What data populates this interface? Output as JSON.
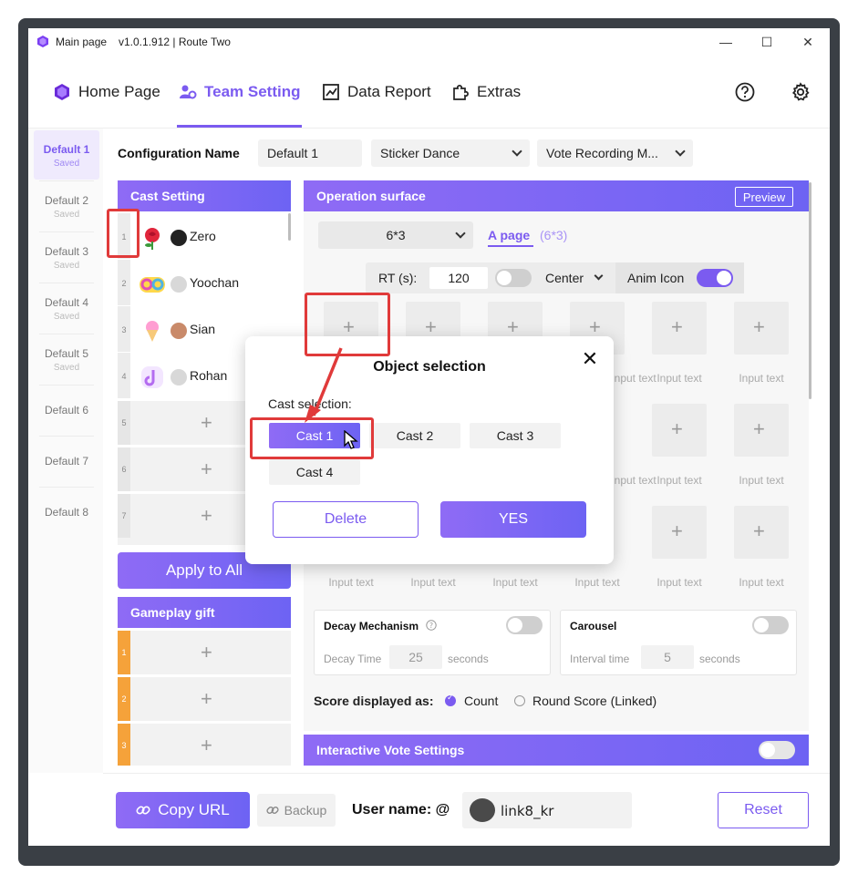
{
  "window": {
    "title": "Main page",
    "version": "v1.0.1.912 | Route Two",
    "minimize": "—",
    "maximize": "☐",
    "close": "✕"
  },
  "nav": {
    "items": [
      {
        "label": "Home Page",
        "icon": "cube-icon"
      },
      {
        "label": "Team Setting",
        "icon": "team-gear-icon"
      },
      {
        "label": "Data Report",
        "icon": "chart-icon"
      },
      {
        "label": "Extras",
        "icon": "puzzle-icon"
      }
    ],
    "help_icon": "question-circle-icon",
    "settings_icon": "gear-icon"
  },
  "configs": [
    {
      "name": "Default 1",
      "status": "Saved"
    },
    {
      "name": "Default 2",
      "status": "Saved"
    },
    {
      "name": "Default 3",
      "status": "Saved"
    },
    {
      "name": "Default 4",
      "status": "Saved"
    },
    {
      "name": "Default 5",
      "status": "Saved"
    },
    {
      "name": "Default 6",
      "status": ""
    },
    {
      "name": "Default 7",
      "status": ""
    },
    {
      "name": "Default 8",
      "status": ""
    }
  ],
  "config_row": {
    "label": "Configuration Name",
    "name_value": "Default 1",
    "sticker_select": "Sticker Dance",
    "mode_select": "Vote Recording M..."
  },
  "cast_setting": {
    "header": "Cast Setting",
    "rows": [
      {
        "num": "1",
        "name": "Zero"
      },
      {
        "num": "2",
        "name": "Yoochan"
      },
      {
        "num": "3",
        "name": "Sian"
      },
      {
        "num": "4",
        "name": "Rohan"
      }
    ],
    "empty_rows": [
      "5",
      "6",
      "7"
    ],
    "plus": "+",
    "apply_label": "Apply to All"
  },
  "gameplay_gift": {
    "header": "Gameplay gift",
    "rows": [
      "1",
      "2",
      "3"
    ]
  },
  "operation": {
    "header": "Operation surface",
    "preview": "Preview",
    "grid_select": "6*3",
    "page_label": "A page",
    "page_sub": "(6*3)",
    "rt_label": "RT (s):",
    "rt_value": "120",
    "align_select": "Center",
    "anim_label": "Anim Icon",
    "input_placeholder": "Input text",
    "decay": {
      "title": "Decay Mechanism",
      "key": "Decay Time",
      "value": "25",
      "unit": "seconds"
    },
    "carousel": {
      "title": "Carousel",
      "key": "Interval time",
      "value": "5",
      "unit": "seconds"
    },
    "score_label": "Score displayed as:",
    "score_opt1": "Count",
    "score_opt2": "Round Score (Linked)",
    "vote_header": "Interactive Vote Settings"
  },
  "bottom": {
    "copy_url": "Copy URL",
    "backup": "Backup",
    "user_label": "User name: @",
    "user_value": "link8_kr",
    "reset": "Reset"
  },
  "modal": {
    "title": "Object selection",
    "sub": "Cast selection:",
    "options": [
      "Cast 1",
      "Cast 2",
      "Cast 3",
      "Cast 4"
    ],
    "delete": "Delete",
    "yes": "YES",
    "close": "✕"
  },
  "colors": {
    "accent": "#7b5bf0",
    "gift": "#f5a23a",
    "annotation": "#e03a3a"
  }
}
